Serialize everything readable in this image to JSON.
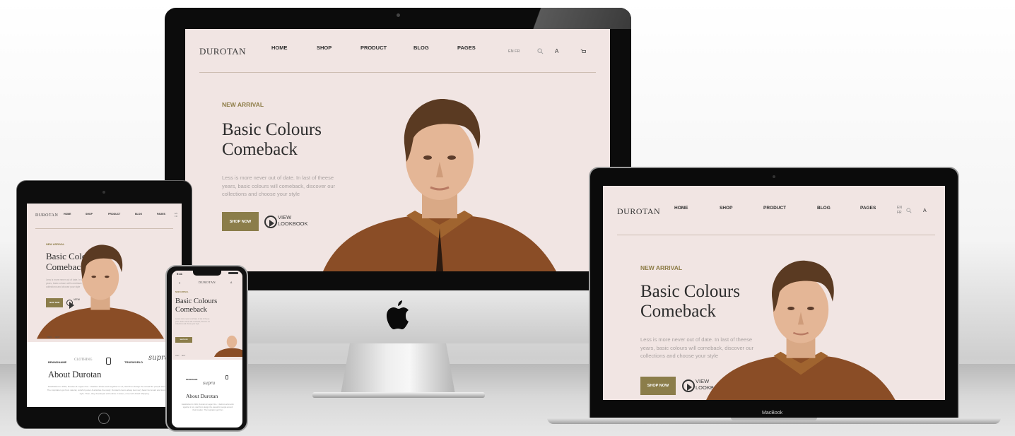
{
  "site": {
    "brand": "DUROTAN",
    "nav": [
      "HOME",
      "SHOP",
      "PRODUCT",
      "BLOG",
      "PAGES"
    ],
    "lang": "EN FR",
    "lang_en": "EN",
    "lang_fr": "FR",
    "account_letter": "A",
    "kicker": "NEW ARRIVAL",
    "headline_line1": "Basic Colours",
    "headline_line2": "Comeback",
    "copy_line1": "Less is more never out of date. In last of theese",
    "copy_line2": "years, basic colours will comeback, discover our",
    "copy_line3": "collections and choose your style",
    "shop_button": "SHOP NOW",
    "view_line1": "VIEW",
    "view_line2": "LOOKBOOK",
    "about_title": "About Durotan",
    "about_text_1": "Established in 1991, Durotan & Logan Ons. 1 fashion artists work together in LA, start from design the casual for people around their location. The inspiration got from natural, colorful poster & artsicles the study. Durotan's items alway look very basic but smart and trendy, mixes with any style. Then, they developed with online 2 stores, cover all United Shipping.",
    "about_text_2": "Established in 1991, Durotan & Logan Ons. 1 fashion artist work together in LA, start from design the casual for people around their location. The inspiration got from",
    "slider_prev": "PREV",
    "slider_next": "NEXT"
  },
  "logos": [
    "BRANDNAME",
    "CLOTHING",
    "TRUEWORLD",
    "supra"
  ],
  "logos_phone": [
    "BRANDNAME",
    "supra"
  ],
  "phone_status": {
    "time": "9:41"
  },
  "laptop_label": "MacBook",
  "icons": [
    "search-icon",
    "cart-icon",
    "menu-icon",
    "play-icon",
    "apple-logo-icon"
  ]
}
